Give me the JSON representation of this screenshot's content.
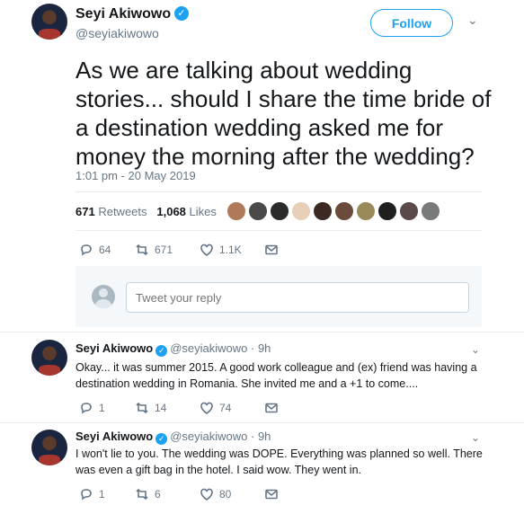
{
  "main_tweet": {
    "author_name": "Seyi Akiwowo",
    "handle": "@seyiakiwowo",
    "follow_label": "Follow",
    "text": "As we are talking about wedding stories... should I share the time bride of a destination wedding asked me for money the morning after the wedding?",
    "time": "1:01 pm - 20 May 2019",
    "retweets_count": "671",
    "retweets_label": "Retweets",
    "likes_count": "1,068",
    "likes_label": "Likes",
    "actions": {
      "replies": "64",
      "retweets": "671",
      "likes": "1.1K"
    }
  },
  "reply_box": {
    "placeholder": "Tweet your reply"
  },
  "replies": [
    {
      "author_name": "Seyi Akiwowo",
      "handle": "@seyiakiwowo",
      "time": "· 9h",
      "text": "Okay... it was summer 2015. A good work colleague and (ex) friend was having a destination wedding in Romania. She invited me and a +1 to come....",
      "actions": {
        "replies": "1",
        "retweets": "14",
        "likes": "74"
      }
    },
    {
      "author_name": "Seyi Akiwowo",
      "handle": "@seyiakiwowo",
      "time": "· 9h",
      "text": "I won't lie to you. The wedding was DOPE. Everything was planned so well. There was even a gift bag in the hotel. I said wow. They went in.",
      "actions": {
        "replies": "1",
        "retweets": "6",
        "likes": "80"
      }
    }
  ],
  "colors": {
    "accent": "#1da1f2",
    "muted": "#657786",
    "text": "#14171a",
    "divider": "#e6ecf0"
  },
  "icons": [
    "reply-icon",
    "retweet-icon",
    "heart-icon",
    "message-icon",
    "verified-icon",
    "chevron-down-icon"
  ]
}
